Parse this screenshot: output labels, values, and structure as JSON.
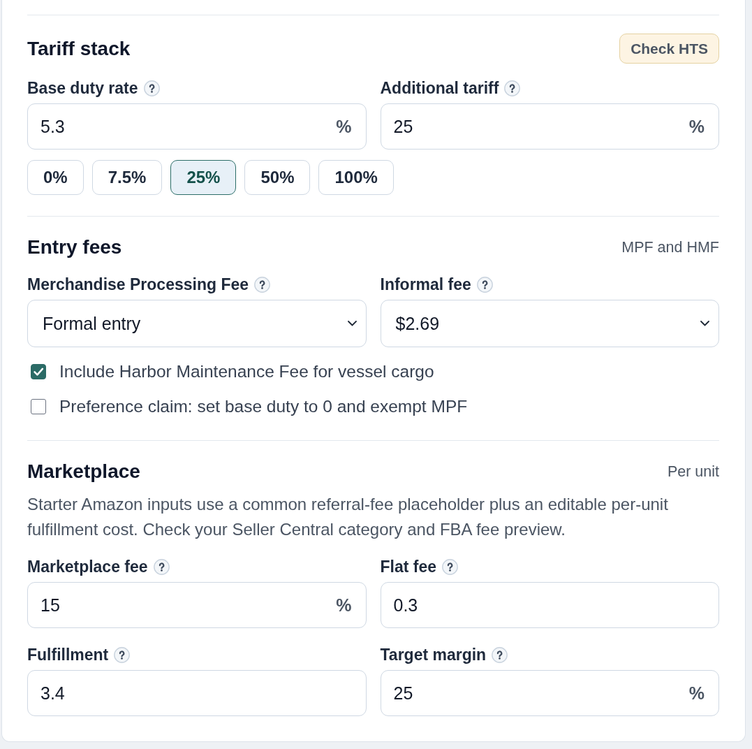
{
  "sections": [
    {
      "title": "Tariff stack",
      "action": "Check HTS",
      "fields": [
        {
          "kind": "number",
          "label": "Base duty rate",
          "value": "5.3",
          "suffix": "%"
        },
        {
          "kind": "number",
          "label": "Additional tariff",
          "value": "25",
          "suffix": "%"
        }
      ],
      "presets": [
        {
          "label": "0%",
          "selected": false
        },
        {
          "label": "7.5%",
          "selected": false
        },
        {
          "label": "25%",
          "selected": true
        },
        {
          "label": "50%",
          "selected": false
        },
        {
          "label": "100%",
          "selected": false
        }
      ]
    },
    {
      "title": "Entry fees",
      "note": "MPF and HMF",
      "fields": [
        {
          "kind": "select",
          "label": "Merchandise Processing Fee",
          "value": "Formal entry"
        },
        {
          "kind": "select",
          "label": "Informal fee",
          "value": "$2.69"
        }
      ],
      "checkboxes": [
        {
          "label": "Include Harbor Maintenance Fee for vessel cargo",
          "checked": true
        },
        {
          "label": "Preference claim: set base duty to 0 and exempt MPF",
          "checked": false
        }
      ]
    },
    {
      "title": "Marketplace",
      "note": "Per unit",
      "description": "Starter Amazon inputs use a common referral-fee placeholder plus an editable per-unit fulfillment cost. Check your Seller Central category and FBA fee preview.",
      "fields": [
        {
          "kind": "number",
          "label": "Marketplace fee",
          "value": "15",
          "suffix": "%"
        },
        {
          "kind": "number",
          "label": "Flat fee",
          "value": "0.3"
        },
        {
          "kind": "number",
          "label": "Fulfillment",
          "value": "3.4"
        },
        {
          "kind": "number",
          "label": "Target margin",
          "value": "25",
          "suffix": "%"
        }
      ]
    }
  ]
}
